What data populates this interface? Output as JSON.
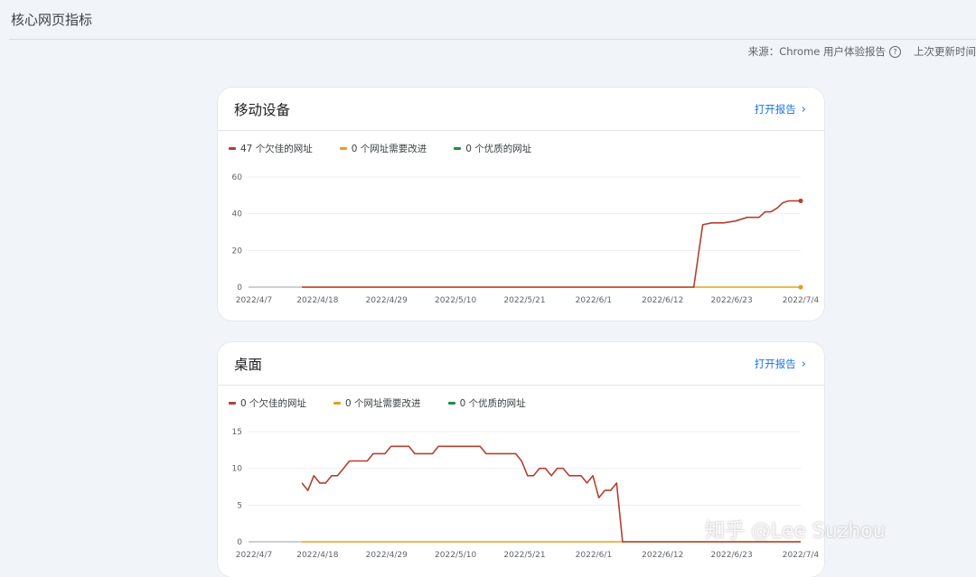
{
  "page": {
    "title": "核心网页指标",
    "source_label": "来源：Chrome 用户体验报告",
    "last_update_label": "上次更新时间"
  },
  "colors": {
    "poor": "#b3402f",
    "needs_improvement": "#e3a01b",
    "good": "#1e8e3e",
    "link": "#1a73e8"
  },
  "icons": {
    "help": "help-circle-icon",
    "chevron": "chevron-right-icon"
  },
  "cards": [
    {
      "title": "移动设备",
      "open_report_label": "打开报告",
      "legend": [
        {
          "label": "47 个欠佳的网址",
          "series": "poor"
        },
        {
          "label": "0 个网址需要改进",
          "series": "needs_improvement"
        },
        {
          "label": "0 个优质的网址",
          "series": "good"
        }
      ]
    },
    {
      "title": "桌面",
      "open_report_label": "打开报告",
      "legend": [
        {
          "label": "0 个欠佳的网址",
          "series": "poor"
        },
        {
          "label": "0 个网址需要改进",
          "series": "needs_improvement"
        },
        {
          "label": "0 个优质的网址",
          "series": "good"
        }
      ]
    }
  ],
  "watermark": "知乎 @Lee Suzhou",
  "chart_data": [
    {
      "type": "line",
      "title": "移动设备",
      "x_ticks": [
        "2022/4/7",
        "2022/4/18",
        "2022/4/29",
        "2022/5/10",
        "2022/5/21",
        "2022/6/1",
        "2022/6/12",
        "2022/6/23",
        "2022/7/4"
      ],
      "y_ticks": [
        0,
        20,
        40,
        60
      ],
      "ylim": [
        0,
        60
      ],
      "xlim_days": [
        0,
        90
      ],
      "grid": true,
      "series": [
        {
          "key": "poor",
          "start_day": 9,
          "points": [
            [
              9,
              0
            ],
            [
              75,
              0
            ],
            [
              76.5,
              34
            ],
            [
              78,
              35
            ],
            [
              80,
              35
            ],
            [
              82,
              36
            ],
            [
              84,
              38
            ],
            [
              86,
              38
            ],
            [
              87,
              41
            ],
            [
              88,
              41
            ],
            [
              89,
              43
            ],
            [
              90,
              46
            ],
            [
              91,
              47
            ],
            [
              93,
              47
            ]
          ]
        },
        {
          "key": "needs_improvement",
          "start_day": 9,
          "points": [
            [
              9,
              0
            ],
            [
              93,
              0
            ]
          ]
        }
      ]
    },
    {
      "type": "line",
      "title": "桌面",
      "x_ticks": [
        "2022/4/7",
        "2022/4/18",
        "2022/4/29",
        "2022/5/10",
        "2022/5/21",
        "2022/6/1",
        "2022/6/12",
        "2022/6/23",
        "2022/7/4"
      ],
      "y_ticks": [
        0,
        5,
        10,
        15
      ],
      "ylim": [
        0,
        15
      ],
      "xlim_days": [
        0,
        90
      ],
      "grid": true,
      "series": [
        {
          "key": "poor",
          "start_day": 9,
          "points": [
            [
              9,
              8
            ],
            [
              10,
              7
            ],
            [
              11,
              9
            ],
            [
              12,
              8
            ],
            [
              13,
              8
            ],
            [
              14,
              9
            ],
            [
              15,
              9
            ],
            [
              16,
              10
            ],
            [
              17,
              11
            ],
            [
              19,
              11
            ],
            [
              20,
              11
            ],
            [
              21,
              12
            ],
            [
              23,
              12
            ],
            [
              24,
              13
            ],
            [
              27,
              13
            ],
            [
              28,
              12
            ],
            [
              31,
              12
            ],
            [
              32,
              13
            ],
            [
              39,
              13
            ],
            [
              40,
              12
            ],
            [
              45,
              12
            ],
            [
              46,
              11
            ],
            [
              47,
              9
            ],
            [
              48,
              9
            ],
            [
              49,
              10
            ],
            [
              50,
              10
            ],
            [
              51,
              9
            ],
            [
              52,
              10
            ],
            [
              53,
              10
            ],
            [
              54,
              9
            ],
            [
              56,
              9
            ],
            [
              57,
              8
            ],
            [
              58,
              9
            ],
            [
              59,
              6
            ],
            [
              60,
              7
            ],
            [
              61,
              7
            ],
            [
              62,
              8
            ],
            [
              63,
              0
            ],
            [
              93,
              0
            ]
          ]
        },
        {
          "key": "needs_improvement",
          "start_day": 9,
          "points": [
            [
              9,
              0
            ],
            [
              93,
              0
            ]
          ]
        }
      ]
    }
  ]
}
